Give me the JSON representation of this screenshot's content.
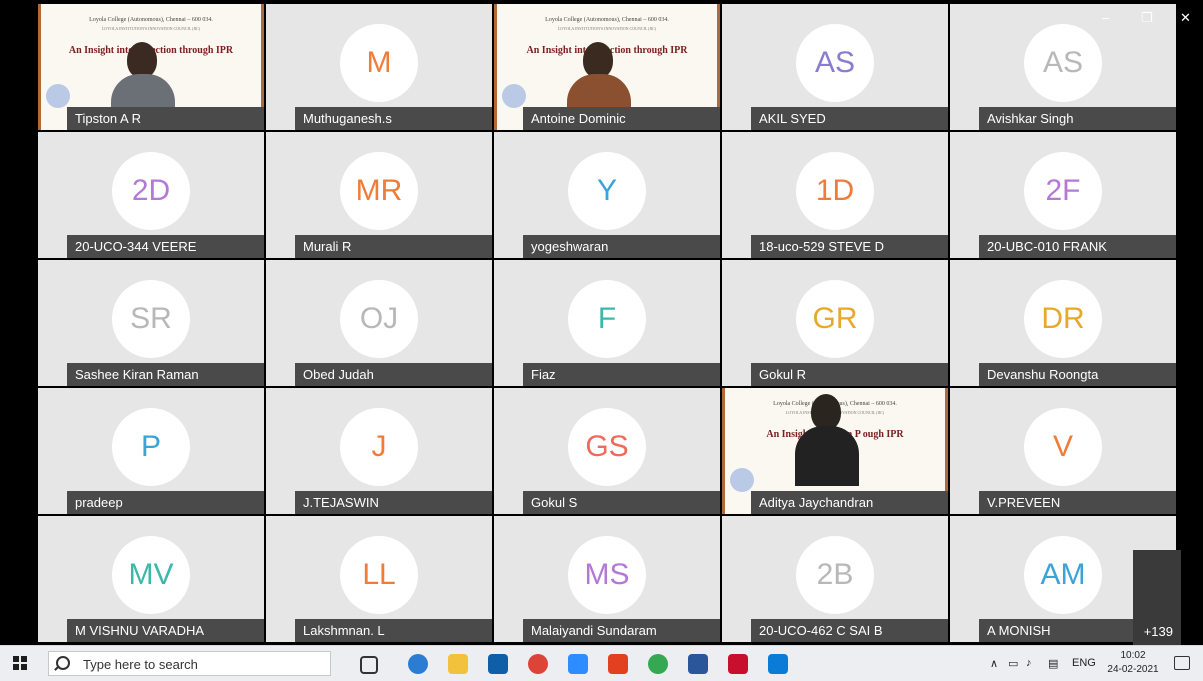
{
  "window_controls": {
    "minimize": "–",
    "maximize": "❐",
    "close": "✕"
  },
  "slides": {
    "college_line": "Loyola College (Autonomous), Chennai – 600 034.",
    "council_line": "LOYOLA INSTITUTION'S INNOVATION COUNCIL (IIC)",
    "title_1": "An Insight into Id        tection through IPR",
    "title_2": "An Insight into Id        ection through IPR",
    "title_3": "An Insight into Idea P        ough IPR"
  },
  "participants": [
    {
      "name": "Tipston A R",
      "video": true
    },
    {
      "name": "Muthuganesh.s",
      "initials": "M",
      "color": "#f07c3a"
    },
    {
      "name": "Antoine Dominic",
      "video": true
    },
    {
      "name": "AKIL SYED",
      "initials": "AS",
      "color": "#8b7bd1"
    },
    {
      "name": "Avishkar Singh",
      "initials": "AS",
      "color": "#b8b8b8"
    },
    {
      "name": "20-UCO-344 VEERE",
      "initials": "2D",
      "color": "#b479d6"
    },
    {
      "name": "Murali R",
      "initials": "MR",
      "color": "#f07c3a"
    },
    {
      "name": "yogeshwaran",
      "initials": "Y",
      "color": "#3aa3d8"
    },
    {
      "name": "18-uco-529 STEVE D",
      "initials": "1D",
      "color": "#f07c3a"
    },
    {
      "name": "20-UBC-010 FRANK",
      "initials": "2F",
      "color": "#b479d6"
    },
    {
      "name": "Sashee Kiran Raman",
      "initials": "SR",
      "color": "#b8b8b8"
    },
    {
      "name": "Obed Judah",
      "initials": "OJ",
      "color": "#b8b8b8"
    },
    {
      "name": "Fiaz",
      "initials": "F",
      "color": "#3cb8a8"
    },
    {
      "name": "Gokul R",
      "initials": "GR",
      "color": "#e6a92a"
    },
    {
      "name": "Devanshu Roongta",
      "initials": "DR",
      "color": "#e6a92a"
    },
    {
      "name": "pradeep",
      "initials": "P",
      "color": "#3aa3d8"
    },
    {
      "name": "J.TEJASWIN",
      "initials": "J",
      "color": "#f07c3a"
    },
    {
      "name": "Gokul S",
      "initials": "GS",
      "color": "#f06a5a"
    },
    {
      "name": "Aditya Jaychandran",
      "video": true
    },
    {
      "name": "V.PREVEEN",
      "initials": "V",
      "color": "#f07c3a"
    },
    {
      "name": "M VISHNU VARADHA",
      "initials": "MV",
      "color": "#3cb8a8"
    },
    {
      "name": "Lakshmnan. L",
      "initials": "LL",
      "color": "#f07c3a"
    },
    {
      "name": "Malaiyandi Sundaram",
      "initials": "MS",
      "color": "#b479d6"
    },
    {
      "name": "20-UCO-462 C SAI B",
      "initials": "2B",
      "color": "#b8b8b8"
    },
    {
      "name": "A MONISH",
      "initials": "AM",
      "color": "#3aa3d8"
    }
  ],
  "overflow_count": "+139",
  "taskbar": {
    "search_placeholder": "Type here to search",
    "apps": [
      "task-view-icon",
      "edge-icon",
      "file-explorer-icon",
      "mail-icon",
      "chrome-icon",
      "zoom-icon",
      "office-icon",
      "chrome-alt-icon",
      "word-icon",
      "acrobat-icon",
      "photos-icon"
    ],
    "tray": {
      "chevron": "∧",
      "language": "ENG"
    },
    "time": "10:02",
    "date": "24-02-2021"
  },
  "colors": {
    "tile_bg": "#e6e6e6",
    "nameplate_bg": "#4a4a4a",
    "stage_bg": "#000000",
    "taskbar_bg": "#eceef2"
  }
}
